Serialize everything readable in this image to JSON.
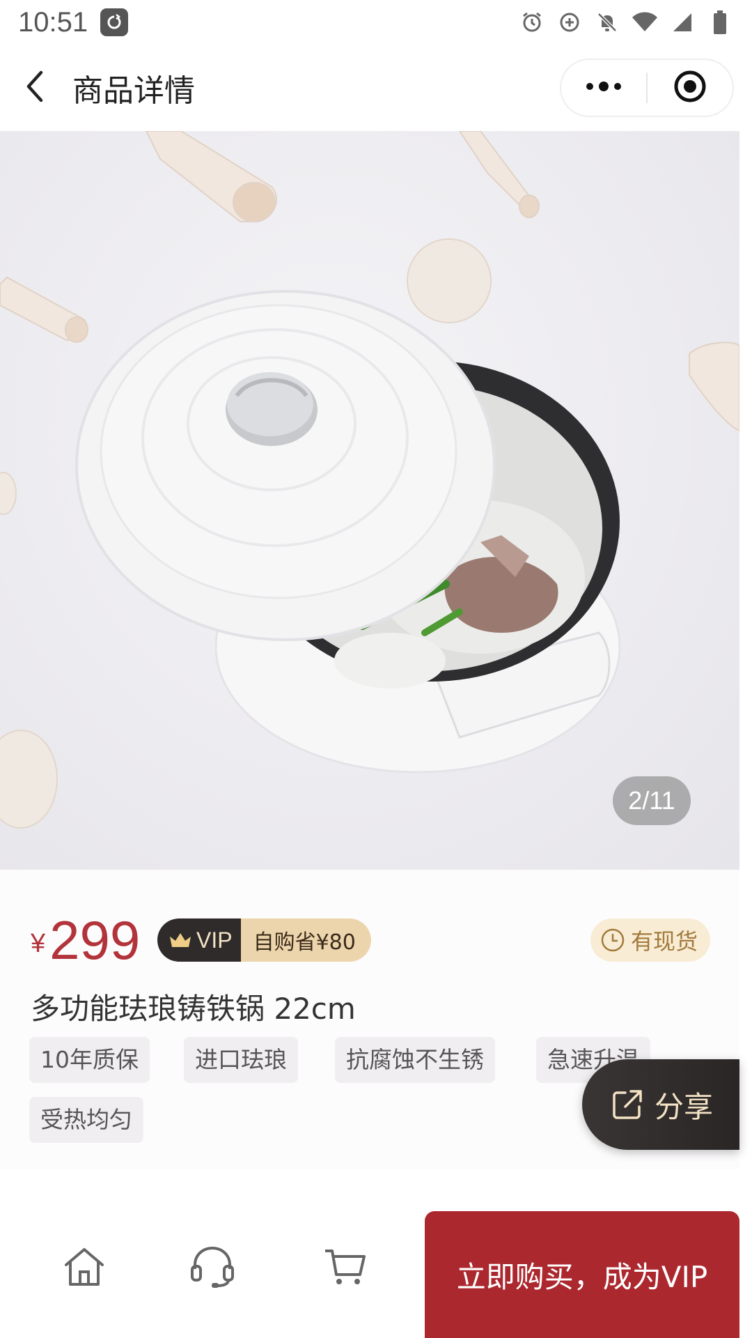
{
  "status_bar": {
    "time": "10:51",
    "icons": [
      "app-icon",
      "alarm-icon",
      "data-saver-icon",
      "bell-off-icon",
      "wifi-icon",
      "signal-icon",
      "battery-icon"
    ]
  },
  "nav": {
    "title": "商品详情",
    "back_icon": "chevron-left-icon",
    "more_icon": "more-dots-icon",
    "close_icon": "target-circle-icon"
  },
  "gallery": {
    "counter": "2/11"
  },
  "product": {
    "currency": "¥",
    "price": "299",
    "vip_label": "VIP",
    "vip_saving": "自购省¥80",
    "stock": "有现货",
    "title": "多功能珐琅铸铁锅 22cm",
    "tags": [
      "10年质保",
      "进口珐琅",
      "抗腐蚀不生锈",
      "急速升温",
      "受热均匀"
    ]
  },
  "share": {
    "label": "分享"
  },
  "bottom_bar": {
    "icons": [
      "home-icon",
      "customer-service-icon",
      "cart-icon"
    ],
    "buy_label": "立即购买，成为VIP"
  },
  "colors": {
    "price": "#b2333a",
    "buy_button": "#ac282f",
    "vip_dark": "#2f2b2b",
    "vip_gold": "#ecd5ac",
    "stock_bg": "#f8ecd4"
  }
}
